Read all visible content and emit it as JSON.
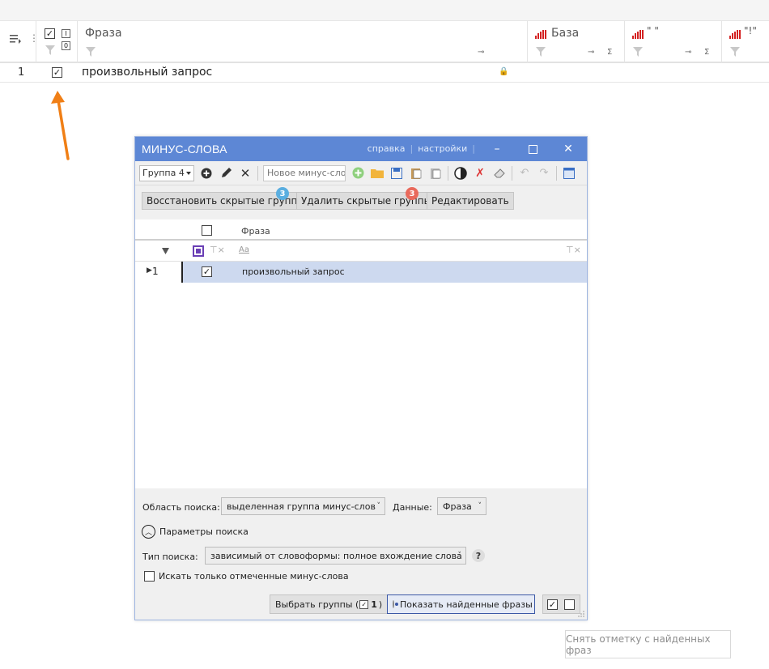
{
  "main_grid": {
    "columns": {
      "phrase": "Фраза",
      "base": "База",
      "quotes": "\" \"",
      "excl": "\"!\""
    },
    "row": {
      "num": "1",
      "phrase": "произвольный запрос"
    },
    "sigma": "Σ",
    "hdr_check_i": "I",
    "hdr_check_o": "0"
  },
  "dialog": {
    "title": "МИНУС-СЛОВА",
    "links": {
      "help": "справка",
      "settings": "настройки"
    },
    "toolbar": {
      "group_select": "Группа 4",
      "new_word_placeholder": "Новое минус-слово"
    },
    "buttons": {
      "restore": "Восстановить скрытые группы",
      "restore_badge": "3",
      "delete": "Удалить скрытые группы",
      "delete_badge": "3",
      "edit": "Редактировать"
    },
    "grid": {
      "phrase_header": "Фраза",
      "filter_placeholder": "Aa",
      "row_num": "1",
      "row_phrase": "произвольный запрос"
    },
    "search": {
      "area_label": "Область поиска:",
      "area_value": "выделенная группа минус-слов",
      "data_label": "Данные:",
      "data_value": "Фраза",
      "params_label": "Параметры поиска",
      "type_label": "Тип поиска:",
      "type_value": "зависимый от словоформы: полное вхождение слова",
      "help": "?",
      "only_checked_label": "Искать только отмеченные минус-слова"
    },
    "footer": {
      "select_groups_prefix": "Выбрать группы (",
      "select_groups_count": "1",
      "select_groups_suffix": ")",
      "show_found": "Показать найденные фразы"
    }
  },
  "outside_button": "Снять отметку с найденных фраз",
  "colors": {
    "title_bar": "#5d87d5",
    "selected_row": "#cdd9ef",
    "arrow": "#f07f16",
    "bars": "#d42121",
    "badge_blue": "#5aaee0",
    "badge_red": "#e96a5c"
  }
}
